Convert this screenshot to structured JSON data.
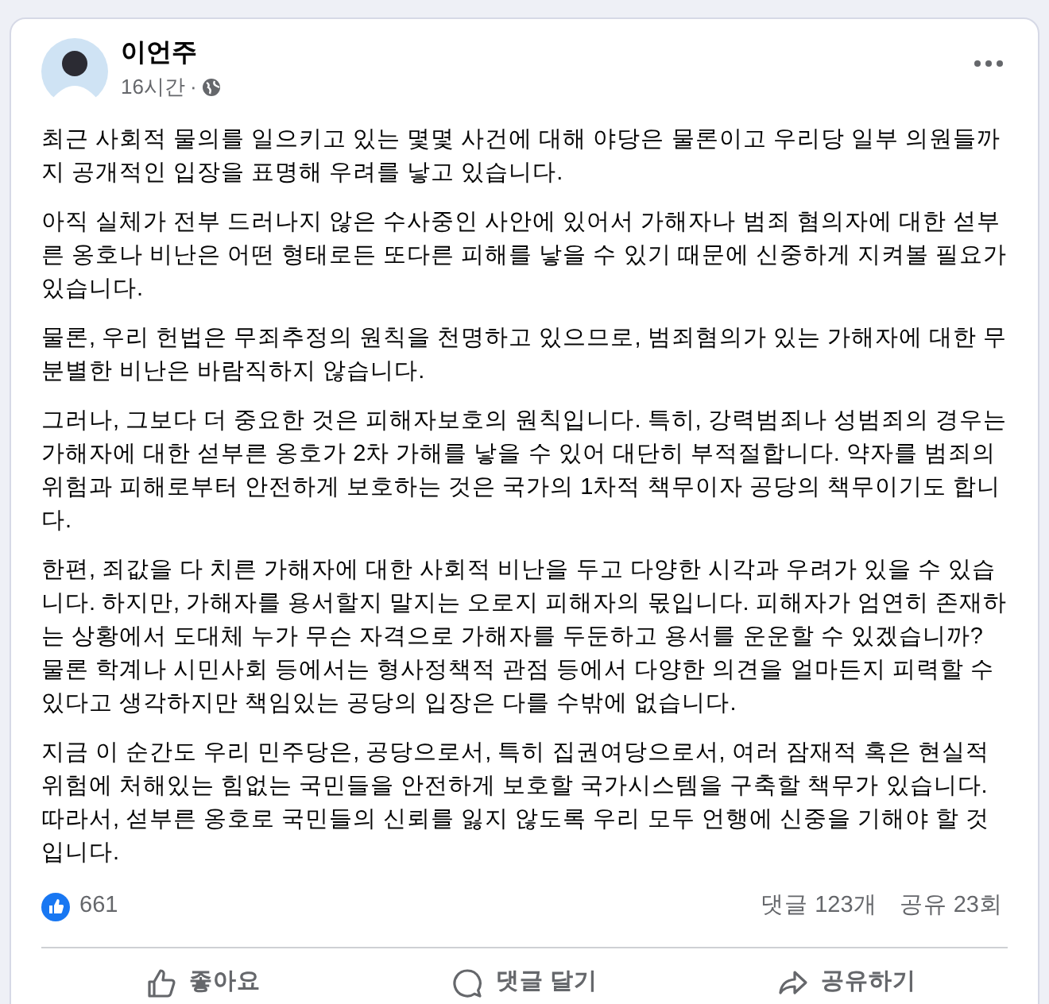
{
  "post": {
    "author": "이언주",
    "time": "16시간",
    "separator": "·",
    "paragraphs": [
      "최근 사회적 물의를 일으키고 있는 몇몇 사건에 대해 야당은 물론이고 우리당 일부 의원들까지 공개적인 입장을 표명해 우려를 낳고 있습니다.",
      "아직 실체가 전부 드러나지 않은 수사중인 사안에 있어서 가해자나 범죄 혐의자에 대한 섣부른 옹호나 비난은 어떤 형태로든 또다른 피해를 낳을 수 있기 때문에 신중하게 지켜볼 필요가 있습니다.",
      "물론, 우리 헌법은 무죄추정의 원칙을 천명하고 있으므로, 범죄혐의가 있는 가해자에 대한 무분별한 비난은 바람직하지 않습니다.",
      "그러나, 그보다 더 중요한 것은 피해자보호의 원칙입니다. 특히, 강력범죄나 성범죄의 경우는 가해자에 대한 섣부른 옹호가 2차 가해를 낳을 수 있어 대단히 부적절합니다. 약자를 범죄의 위험과 피해로부터 안전하게 보호하는 것은 국가의 1차적 책무이자 공당의 책무이기도 합니다.",
      "한편, 죄값을 다 치른 가해자에 대한 사회적 비난을 두고 다양한 시각과 우려가 있을 수 있습니다. 하지만, 가해자를 용서할지 말지는 오로지 피해자의 몫입니다. 피해자가 엄연히 존재하는 상황에서 도대체 누가 무슨 자격으로 가해자를 두둔하고 용서를 운운할 수 있겠습니까? 물론 학계나 시민사회 등에서는 형사정책적 관점 등에서 다양한 의견을 얼마든지 피력할 수 있다고 생각하지만 책임있는 공당의 입장은 다를 수밖에 없습니다.",
      "지금 이 순간도 우리 민주당은, 공당으로서, 특히 집권여당으로서, 여러 잠재적 혹은 현실적 위험에 처해있는 힘없는 국민들을 안전하게 보호할 국가시스템을 구축할 책무가 있습니다. 따라서, 섣부른 옹호로 국민들의 신뢰를 잃지 않도록 우리 모두 언행에 신중을 기해야 할 것입니다."
    ],
    "reactions": "661",
    "comments": "댓글 123개",
    "shares": "공유 23회",
    "actions": [
      {
        "kind": "like",
        "label": "좋아요"
      },
      {
        "kind": "comment",
        "label": "댓글 달기"
      },
      {
        "kind": "share",
        "label": "공유하기"
      }
    ]
  }
}
